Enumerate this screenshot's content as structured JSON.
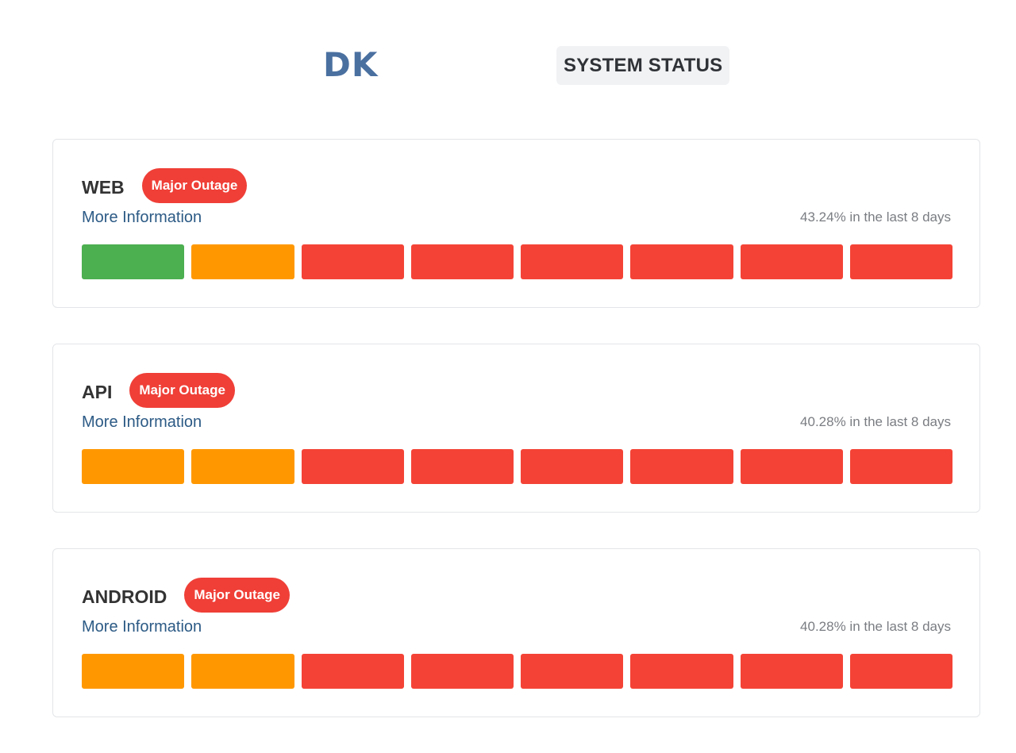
{
  "header": {
    "logo_text": "DK",
    "title": "SYSTEM STATUS"
  },
  "colors": {
    "operational": "#4caf50",
    "degraded": "#ff9800",
    "outage": "#f44336",
    "badge_outage": "#ef3f37",
    "link": "#2c5a85"
  },
  "services": [
    {
      "name": "WEB",
      "status_label": "Major Outage",
      "more_info_label": "More Information",
      "uptime_text": "43.24% in the last 8 days",
      "days": [
        "operational",
        "degraded",
        "outage",
        "outage",
        "outage",
        "outage",
        "outage",
        "outage"
      ]
    },
    {
      "name": "API",
      "status_label": "Major Outage",
      "more_info_label": "More Information",
      "uptime_text": "40.28% in the last 8 days",
      "days": [
        "degraded",
        "degraded",
        "outage",
        "outage",
        "outage",
        "outage",
        "outage",
        "outage"
      ]
    },
    {
      "name": "ANDROID",
      "status_label": "Major Outage",
      "more_info_label": "More Information",
      "uptime_text": "40.28% in the last 8 days",
      "days": [
        "degraded",
        "degraded",
        "outage",
        "outage",
        "outage",
        "outage",
        "outage",
        "outage"
      ]
    }
  ]
}
